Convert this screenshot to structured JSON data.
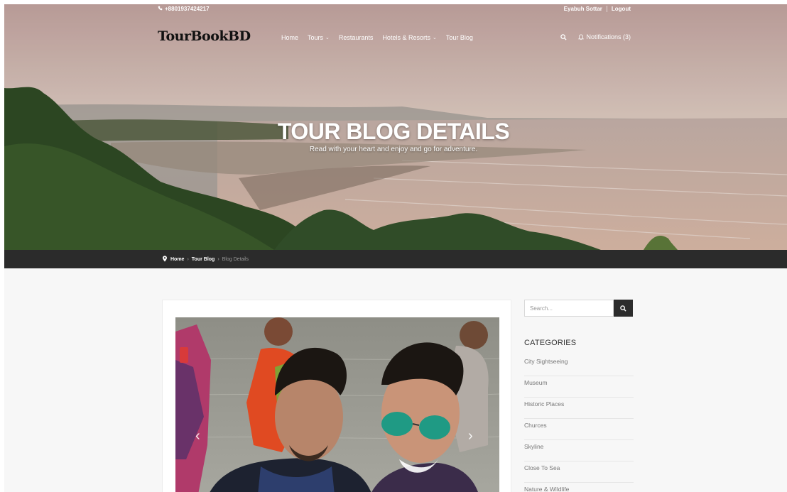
{
  "topbar": {
    "phone": "+8801937424217",
    "user_name": "Eyabuh Sottar",
    "logout": "Logout"
  },
  "navbar": {
    "logo": "TourBookBD",
    "menu": [
      {
        "label": "Home"
      },
      {
        "label": "Tours",
        "dropdown": true
      },
      {
        "label": "Restaurants"
      },
      {
        "label": "Hotels & Resorts",
        "dropdown": true
      },
      {
        "label": "Tour Blog"
      }
    ],
    "notifications": "Notifications (3)"
  },
  "hero": {
    "title": "TOUR BLOG DETAILS",
    "subtitle": "Read with your heart and enjoy and go for adventure."
  },
  "breadcrumb": {
    "home": "Home",
    "blog": "Tour Blog",
    "current": "Blog Details"
  },
  "sidebar": {
    "search_placeholder": "Search...",
    "categories_title": "CATEGORIES",
    "categories": [
      "City Sightseeing",
      "Museum",
      "Historic Places",
      "Churces",
      "Skyline",
      "Close To Sea",
      "Nature & Wildlife"
    ]
  },
  "icons": {
    "search": "search-icon",
    "bell": "bell-icon",
    "phone": "phone-icon",
    "location": "map-pin-icon"
  },
  "colors": {
    "breadcrumb_bg": "#2b2b2b",
    "search_button": "#2c2c2c",
    "main_bg": "#f7f7f7"
  }
}
